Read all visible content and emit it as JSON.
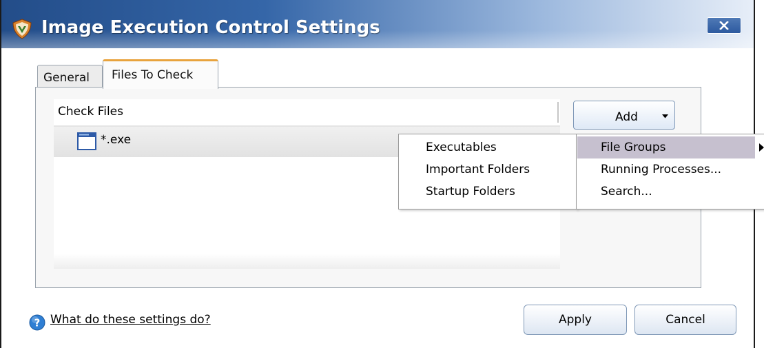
{
  "window": {
    "title": "Image Execution Control Settings",
    "close_icon": "close-icon"
  },
  "tabs": [
    {
      "label": "General",
      "selected": false
    },
    {
      "label": "Files To Check",
      "selected": true
    }
  ],
  "file_list": {
    "column_header": "Check Files",
    "rows": [
      {
        "icon": "window-file-icon",
        "name": "*.exe"
      }
    ]
  },
  "add_button": {
    "label": "Add",
    "icon": "dropdown-arrow-icon"
  },
  "add_menu": {
    "items": [
      {
        "label": "File Groups",
        "highlighted": true,
        "has_submenu": true
      },
      {
        "label": "Running Processes..."
      },
      {
        "label": "Search..."
      }
    ]
  },
  "file_groups_submenu": {
    "items": [
      {
        "label": "Executables"
      },
      {
        "label": "Important Folders"
      },
      {
        "label": "Startup Folders"
      }
    ]
  },
  "footer": {
    "help_icon": "help-icon",
    "help_link": "What do these settings do?",
    "apply_label": "Apply",
    "cancel_label": "Cancel"
  },
  "colors": {
    "menu_highlight": "#c6c0cf",
    "active_tab_accent": "#e8a33d",
    "title_gradient_start": "#234d89"
  }
}
